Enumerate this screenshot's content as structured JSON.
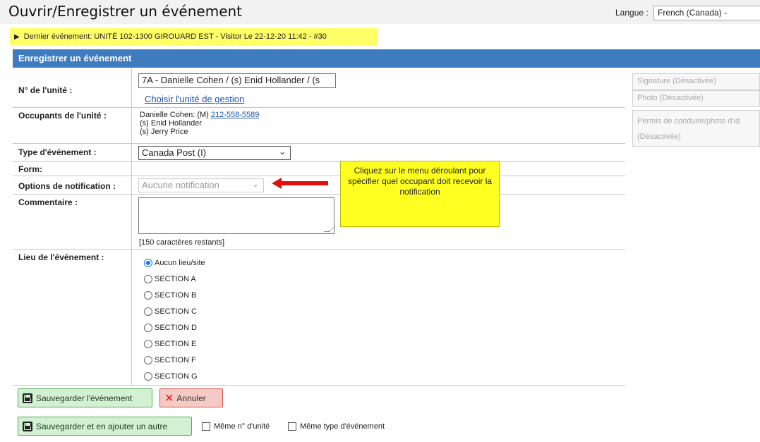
{
  "header": {
    "title": "Ouvrir/Enregistrer un événement",
    "language_label": "Langue :",
    "language_value": "French (Canada) -"
  },
  "last_event": {
    "text": "Dernier événement: UNITÉ 102-1300 GIROUARD EST - Visitor Le 22-12-20 11:42 - #30"
  },
  "panel": {
    "title": "Enregistrer un événement"
  },
  "form": {
    "unit_label": "N° de l'unité :",
    "unit_value": "7A - Danielle Cohen / (s) Enid Hollander / (s",
    "choose_unit_link": "Choisir l'unité de gestion",
    "occupants_label": "Occupants de l'unité :",
    "occupants": {
      "line1_prefix": "Danielle Cohen: (M)",
      "line1_phone": "212-558-5589",
      "line2": "(s) Enid Hollander",
      "line3": "(s) Jerry Price"
    },
    "event_type_label": "Type d'événement :",
    "event_type_value": "Canada Post (I)",
    "form_label": "Form:",
    "notification_label": "Options de notification :",
    "notification_value": "Aucune notification",
    "comment_label": "Commentaire :",
    "chars_remaining": "[150 caractères restants]",
    "location_label": "Lieu de l'événement :",
    "locations": [
      {
        "label": "Aucun lieu/site",
        "checked": true
      },
      {
        "label": "SECTION A",
        "checked": false
      },
      {
        "label": "SECTION B",
        "checked": false
      },
      {
        "label": "SECTION C",
        "checked": false
      },
      {
        "label": "SECTION D",
        "checked": false
      },
      {
        "label": "SECTION E",
        "checked": false
      },
      {
        "label": "SECTION F",
        "checked": false
      },
      {
        "label": "SECTION G",
        "checked": false
      }
    ]
  },
  "side": {
    "signature": "Signature (Désactivée)",
    "photo": "Photo (Désactivée)",
    "license_line1": "Permis de conduire/photo d'id",
    "license_line2": "(Désactivée)"
  },
  "callout": {
    "text": "Cliquez sur le menu déroulant pour spécifier quel occupant doit recevoir la notification"
  },
  "actions": {
    "save": "Sauvegarder l'événement",
    "cancel": "Annuler",
    "save_add": "Sauvegarder et en ajouter un autre",
    "same_unit": "Même n° d'unité",
    "same_type": "Même type d'événement"
  },
  "colors": {
    "header_blue": "#3e7cbf",
    "highlight_yellow": "#ffff66",
    "callout_yellow": "#ffff22",
    "arrow_red": "#e01010",
    "save_green": "#d4f0d4",
    "cancel_red": "#f5c9c4"
  }
}
